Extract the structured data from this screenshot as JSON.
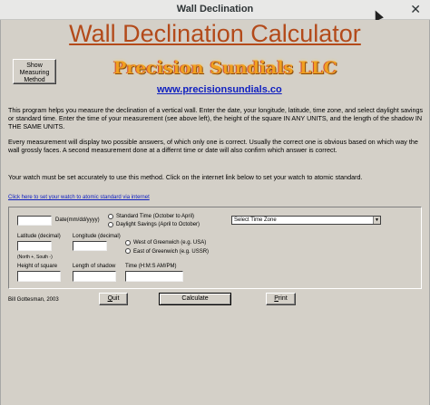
{
  "window": {
    "title": "Wall Declination",
    "close_glyph": "✕"
  },
  "header": {
    "title": "Wall Declination Calculator",
    "show_button": [
      "Show",
      "Measuring",
      "Method"
    ],
    "logo_text": "Precision Sundials LLC",
    "website": "www.precisionsundials.co"
  },
  "body": {
    "p1": "This program helps you measure the declination of a vertical wall.  Enter the date, your longitude, latitude, time zone, and select daylight savings or standard time.  Enter the time of your measurement (see above left), the height of the square IN ANY UNITS, and the length of the shadow IN THE SAME UNITS.",
    "p2": "Every measurement will display two possible answers, of which only one is correct.  Usually the correct one is obvious based on which way the wall grossly faces.  A second measurement done at a differnt time or date will also confirm which answer is correct.",
    "p3": "Your watch must be set accurately to use this method.  Click on the internet link below to set your watch to atomic standard.",
    "atomic_link": "Click here to set your watch to atomic standard via internet"
  },
  "form": {
    "date_label": "Date(mm/dd/yyyy)",
    "standard_time": "Standard Time (October to April)",
    "daylight_savings": "Daylight Savings (April to October)",
    "timezone_selected": "Select Time Zone",
    "latitude_label": "Latitude (decimal)",
    "latitude_hint": "(North +, South -)",
    "longitude_label": "Longitude (decimal)",
    "west_label": "West of Greenwich (e.g. USA)",
    "east_label": "East of Greenwich (e.g. USSR)",
    "height_label": "Height of square",
    "shadow_label": "Length of shadow",
    "time_label": "Time (H:M:S AM/PM)"
  },
  "footer": {
    "author": "Bill Gottesman, 2003",
    "quit_u": "Q",
    "quit_rest": "uit",
    "calculate": "Calculate",
    "print_u": "P",
    "print_rest": "rint"
  }
}
